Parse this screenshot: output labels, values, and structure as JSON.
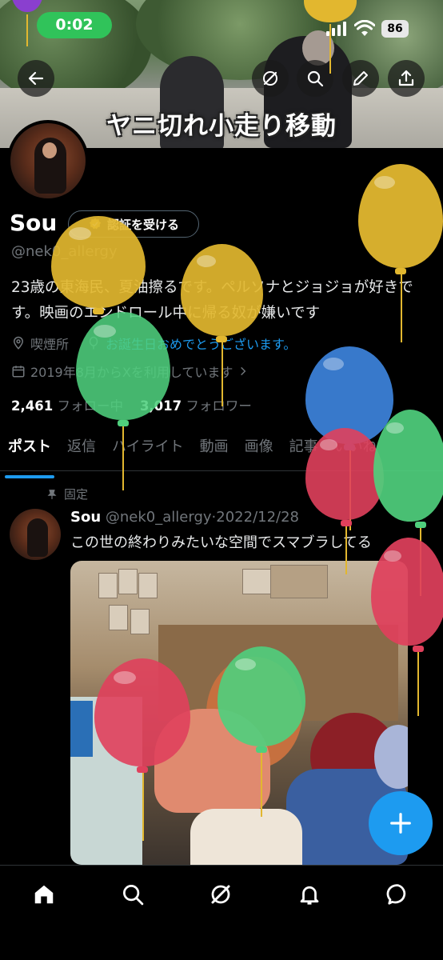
{
  "status_bar": {
    "time": "0:02",
    "battery": "86"
  },
  "header": {
    "banner_caption": "ヤニ切れ小走り移動",
    "icons": [
      "back-arrow-icon",
      "grok-icon",
      "search-icon",
      "pencil-icon",
      "share-icon"
    ]
  },
  "profile": {
    "display_name": "Sou",
    "verify_label": "認証を受ける",
    "handle": "@nek0_allergy",
    "bio": "23歳の東海民、夏油擦るです。ペルソナとジョジョが好きです。映画のエンドロール中に帰る奴が嫌いです",
    "location": "喫煙所",
    "birthday": "お誕生日おめでとうございます。",
    "joined": "2019年8月からXを利用しています",
    "following_count": "2,461",
    "following_label": "フォロー中",
    "followers_count": "3,017",
    "followers_label": "フォロワー"
  },
  "tabs": [
    {
      "label": "ポスト",
      "active": true
    },
    {
      "label": "返信",
      "active": false
    },
    {
      "label": "ハイライト",
      "active": false
    },
    {
      "label": "動画",
      "active": false
    },
    {
      "label": "画像",
      "active": false
    },
    {
      "label": "記事",
      "active": false
    },
    {
      "label": "いいね",
      "active": false
    }
  ],
  "pinned_post": {
    "pinned_label": "固定",
    "name": "Sou",
    "handle": "@nek0_allergy",
    "date": "2022/12/28",
    "text": "この世の終わりみたいな空間でスマブラしてる"
  },
  "fab_label": "+",
  "bottom_nav": [
    "home-icon",
    "search-icon",
    "grok-icon",
    "notifications-icon",
    "messages-icon"
  ],
  "colors": {
    "accent": "#1d9bf0",
    "balloon_yellow": "#e2b72f",
    "balloon_green": "#4fcf7d",
    "balloon_red": "#e0405c",
    "balloon_blue": "#3b7fd6",
    "balloon_purple": "#8a3fcf",
    "status_pill": "#30c35a"
  }
}
